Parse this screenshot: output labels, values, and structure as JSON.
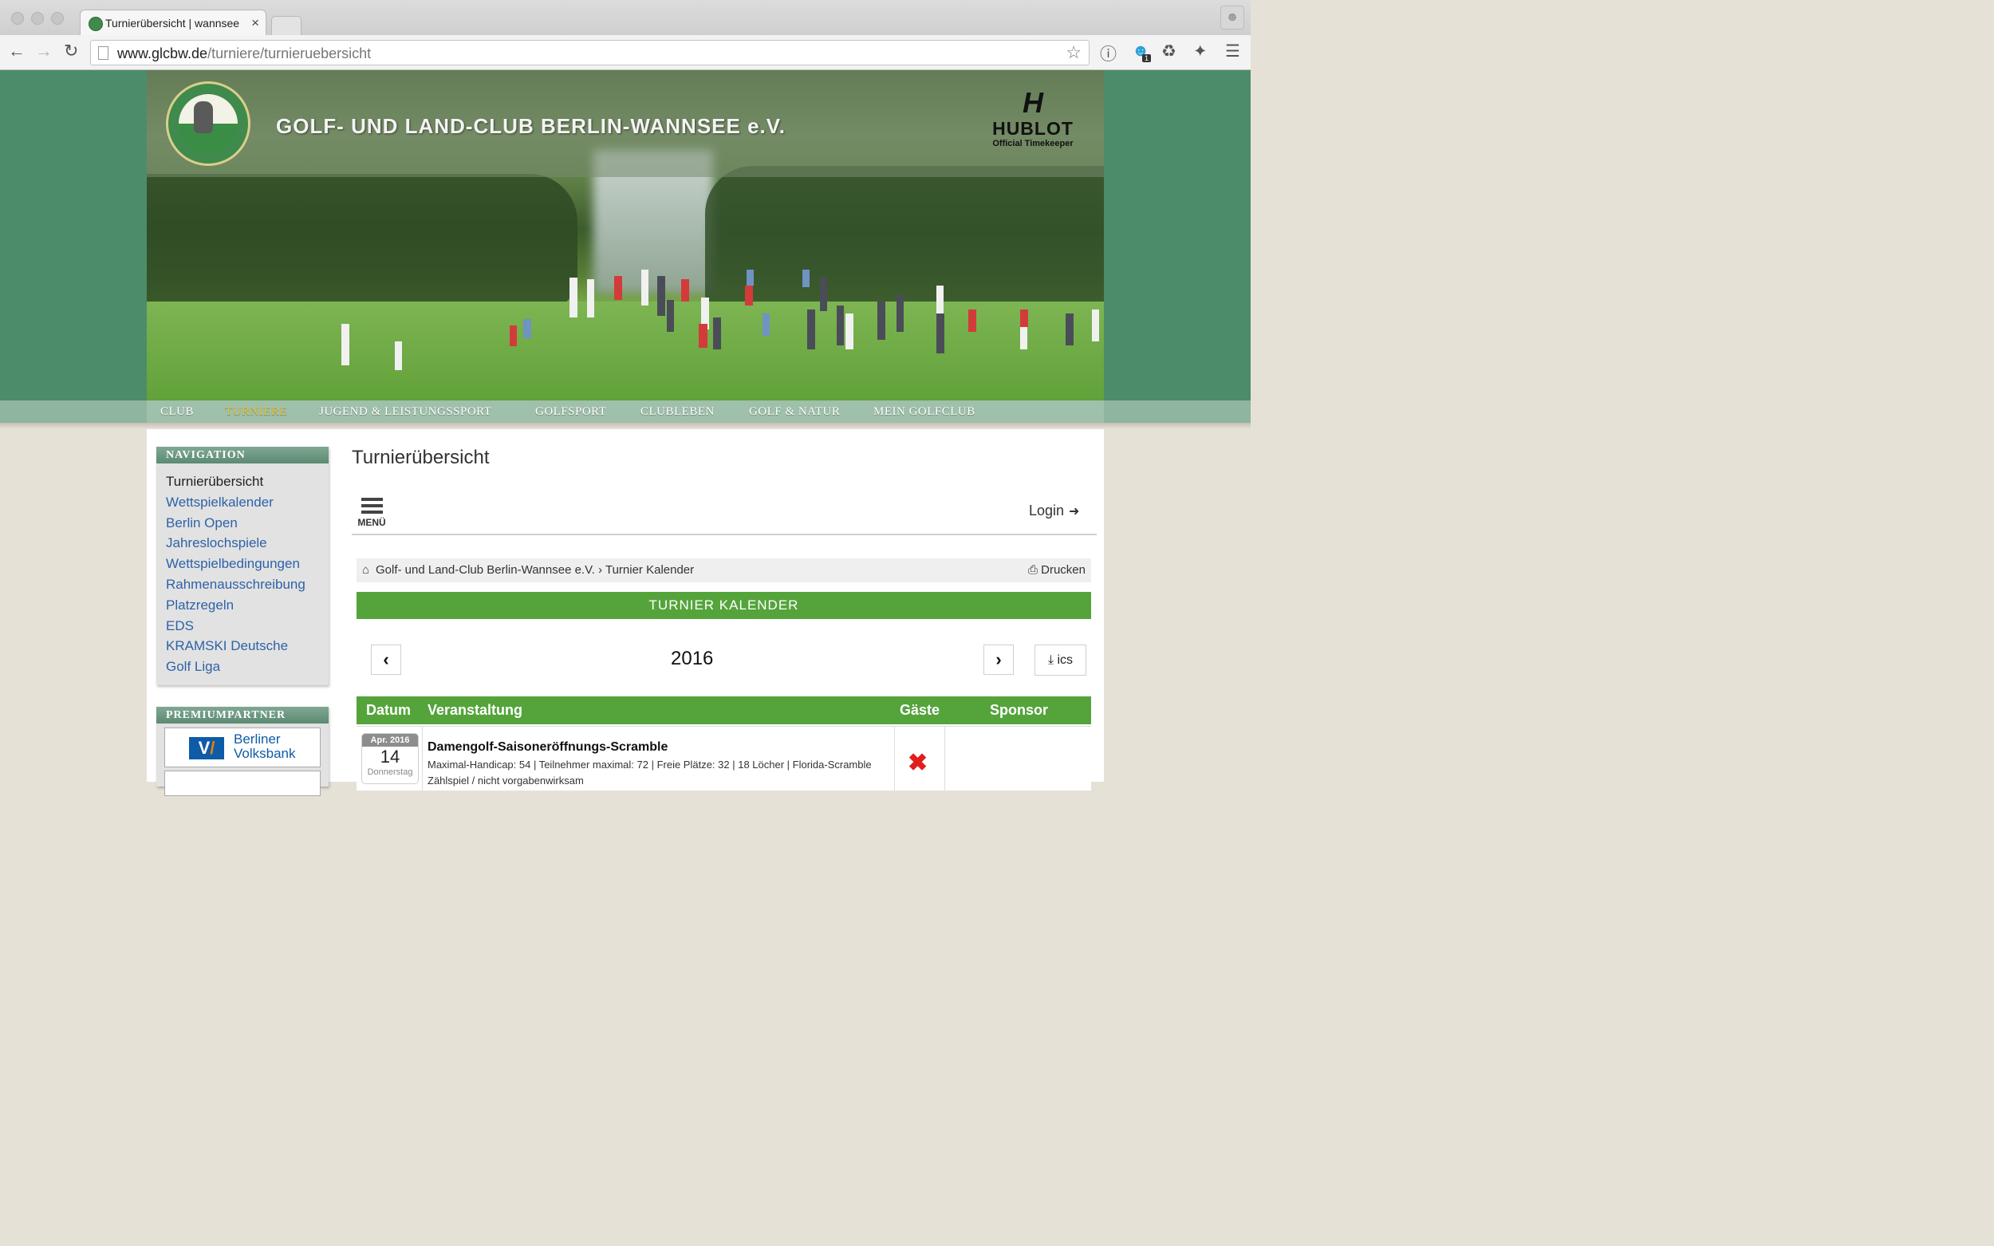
{
  "browser": {
    "tab_title": "Turnierübersicht | wannsee",
    "tab_close": "×",
    "url_host": "www.glcbw.de",
    "url_path": "/turniere/turnieruebersicht",
    "icons": [
      "back-icon",
      "forward-icon",
      "reload-icon",
      "page-icon",
      "star-icon",
      "info-icon",
      "ghost-extension-icon",
      "recycle-icon",
      "puzzle-icon",
      "hamburger-menu-icon"
    ],
    "extension_badge": "1"
  },
  "site": {
    "title": "GOLF- UND LAND-CLUB BERLIN-WANNSEE e.V.",
    "sponsor_brand": "HUBLOT",
    "sponsor_sub": "Official Timekeeper",
    "main_nav": [
      {
        "label": "CLUB",
        "active": false
      },
      {
        "label": "TURNIERE",
        "active": true
      },
      {
        "label": "JUGEND & LEISTUNGSSPORT",
        "active": false
      },
      {
        "label": "GOLFSPORT",
        "active": false
      },
      {
        "label": "CLUBLEBEN",
        "active": false
      },
      {
        "label": "GOLF & NATUR",
        "active": false
      },
      {
        "label": "MEIN GOLFCLUB",
        "active": false
      }
    ]
  },
  "sidebar": {
    "heading": "NAVIGATION",
    "items": [
      {
        "label": "Turnierübersicht",
        "current": true
      },
      {
        "label": "Wettspielkalender"
      },
      {
        "label": "Berlin Open"
      },
      {
        "label": "Jahreslochspiele"
      },
      {
        "label": "Wettspielbedingungen"
      },
      {
        "label": "Rahmenausschreibung"
      },
      {
        "label": "Platzregeln"
      },
      {
        "label": "EDS"
      },
      {
        "label": "KRAMSKI Deutsche"
      },
      {
        "label": "Golf Liga"
      }
    ],
    "partner_heading": "PREMIUMPARTNER",
    "partner_name_1": "Berliner",
    "partner_name_2": "Volksbank"
  },
  "main": {
    "page_title": "Turnierübersicht",
    "menu_label": "MENÜ",
    "login_label": "Login",
    "breadcrumb": {
      "home": "Golf- und Land-Club Berlin-Wannsee e.V.",
      "separator": "›",
      "current": "Turnier Kalender"
    },
    "print_label": "Drucken",
    "calendar_heading": "TURNIER KALENDER",
    "year": "2016",
    "ics_label": "ics",
    "table_headers": {
      "datum": "Datum",
      "veranstaltung": "Veranstaltung",
      "gaeste": "Gäste",
      "sponsor": "Sponsor"
    },
    "events": [
      {
        "month": "Apr. 2016",
        "day": "14",
        "weekday": "Donnerstag",
        "title": "Damengolf-Saisoneröffnungs-Scramble",
        "info": "Maximal-Handicap: 54 | Teilnehmer maximal: 72 | Freie Plätze: 32 | 18 Löcher | Florida-Scramble",
        "info2": "Zählspiel / nicht vorgabenwirksam",
        "guests_allowed": false,
        "sponsor": ""
      }
    ]
  }
}
